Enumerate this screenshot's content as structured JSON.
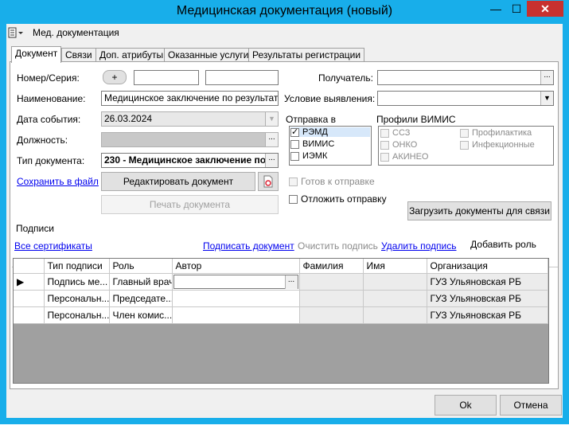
{
  "window": {
    "title": "Медицинская документация (новый)",
    "min_glyph": "—",
    "max_glyph": "☐",
    "close_glyph": "✕"
  },
  "menubar": {
    "doc_label": "Мед. документация"
  },
  "tabs": [
    "Документ",
    "Связи",
    "Доп. атрибуты",
    "Оказанные услуги",
    "Результаты регистрации"
  ],
  "form": {
    "number_label": "Номер/Серия:",
    "plus_label": "+",
    "name_label": "Наименование:",
    "name_value": "Медицинское заключение по результатам",
    "date_label": "Дата события:",
    "date_value": "26.03.2024",
    "position_label": "Должность:",
    "doctype_label": "Тип документа:",
    "doctype_value": "230 - Медицинское заключение по",
    "recipient_label": "Получатель:",
    "condition_label": "Условие выявления:",
    "ellipsis": "...",
    "dropdown_arrow": "▼"
  },
  "send_to": {
    "label": "Отправка в",
    "items": [
      {
        "label": "РЭМД",
        "checked": true
      },
      {
        "label": "ВИМИС",
        "checked": false
      },
      {
        "label": "ИЭМК",
        "checked": false
      }
    ]
  },
  "vimis": {
    "label": "Профили ВИМИС",
    "items": [
      "ССЗ",
      "Профилактика",
      "ОНКО",
      "Инфекционные",
      "АКИНЕО"
    ]
  },
  "actions": {
    "save_link": "Сохранить в файл",
    "edit_button": "Редактировать документ",
    "print_button": "Печать документа",
    "ready_label": "Готов к отправке",
    "postpone_label": "Отложить отправку",
    "load_button": "Загрузить документы для связи"
  },
  "signatures": {
    "group_label": "Подписи",
    "all_certs": "Все сертификаты",
    "sign": "Подписать документ",
    "clear": "Очистить подпись",
    "delete": "Удалить подпись",
    "add_role": "Добавить роль",
    "columns": [
      "Тип подписи",
      "Роль",
      "Автор",
      "Фамилия",
      "Имя",
      "Организация"
    ],
    "rows": [
      [
        "Подпись ме...",
        "Главный врач",
        "",
        "",
        "",
        "ГУЗ Ульяновская РБ"
      ],
      [
        "Персональн...",
        "Председате...",
        "",
        "",
        "",
        "ГУЗ Ульяновская РБ"
      ],
      [
        "Персональн...",
        "Член комис...",
        "",
        "",
        "",
        "ГУЗ Ульяновская РБ"
      ]
    ]
  },
  "footer": {
    "ok": "Ok",
    "cancel": "Отмена"
  }
}
